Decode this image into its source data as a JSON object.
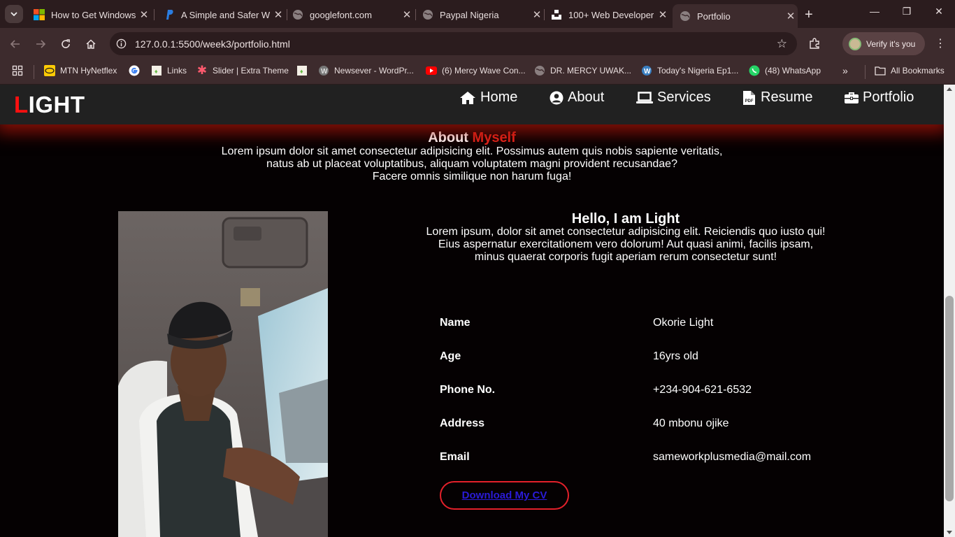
{
  "browser": {
    "tabs": [
      {
        "title": "How to Get Windows",
        "icon": "windows-icon",
        "active": false
      },
      {
        "title": "A Simple and Safer W",
        "icon": "paypal-icon",
        "active": false
      },
      {
        "title": "googlefont.com",
        "icon": "globe-icon",
        "active": false
      },
      {
        "title": "Paypal Nigeria",
        "icon": "globe-icon",
        "active": false
      },
      {
        "title": "100+ Web Developer",
        "icon": "unsplash-icon",
        "active": false
      },
      {
        "title": "Portfolio",
        "icon": "globe-icon",
        "active": true
      }
    ],
    "url": "127.0.0.1:5500/week3/portfolio.html",
    "profile_label": "Verify it's you",
    "bookmarks": [
      {
        "label": "MTN HyNetflex",
        "icon": "mtn-icon"
      },
      {
        "label": "",
        "icon": "google-icon"
      },
      {
        "label": "Links",
        "icon": "doc-icon"
      },
      {
        "label": "Slider | Extra Theme",
        "icon": "star-icon"
      },
      {
        "label": "",
        "icon": "doc-icon"
      },
      {
        "label": "Newsever - WordPr...",
        "icon": "wordpress-icon"
      },
      {
        "label": "(6) Mercy Wave Con...",
        "icon": "youtube-icon"
      },
      {
        "label": "DR. MERCY UWAK...",
        "icon": "globe-icon"
      },
      {
        "label": "Today's Nigeria Ep1...",
        "icon": "wordpress-icon"
      },
      {
        "label": "(48) WhatsApp",
        "icon": "whatsapp-icon"
      }
    ],
    "all_bookmarks_label": "All Bookmarks",
    "colors": {
      "frame": "#2b1c1e",
      "toolbar": "#3d2b2d"
    }
  },
  "site": {
    "logo_first": "L",
    "logo_rest": "IGHT",
    "nav": [
      {
        "label": "Home",
        "icon": "home-icon"
      },
      {
        "label": "About",
        "icon": "user-circle-icon"
      },
      {
        "label": "Services",
        "icon": "laptop-icon"
      },
      {
        "label": "Resume",
        "icon": "pdf-file-icon"
      },
      {
        "label": "Portfolio",
        "icon": "briefcase-icon"
      }
    ],
    "about": {
      "title_plain": "About",
      "title_highlight": "Myself",
      "lines": [
        "Lorem ipsum dolor sit amet consectetur adipisicing elit. Possimus autem quis nobis sapiente veritatis,",
        "natus ab ut placeat voluptatibus, aliquam voluptatem magni provident recusandae?",
        "Facere omnis similique non harum fuga!"
      ]
    },
    "hello": {
      "title": "Hello, I am Light",
      "lines": [
        "Lorem ipsum, dolor sit amet consectetur adipisicing elit. Reiciendis quo iusto qui!",
        "Eius aspernatur exercitationem vero dolorum! Aut quasi animi, facilis ipsam,",
        "minus quaerat corporis fugit aperiam rerum consectetur sunt!"
      ]
    },
    "info": [
      {
        "label": "Name",
        "value": "Okorie Light"
      },
      {
        "label": "Age",
        "value": "16yrs old"
      },
      {
        "label": "Phone No.",
        "value": "+234-904-621-6532"
      },
      {
        "label": "Address",
        "value": "40 mbonu ojike"
      },
      {
        "label": "Email",
        "value": "sameworkplusmedia@mail.com"
      }
    ],
    "cv_button": "Download My CV",
    "colors": {
      "accent": "#e0231a",
      "header": "#212121",
      "background": "#050102",
      "link": "#2a1bd8"
    }
  }
}
